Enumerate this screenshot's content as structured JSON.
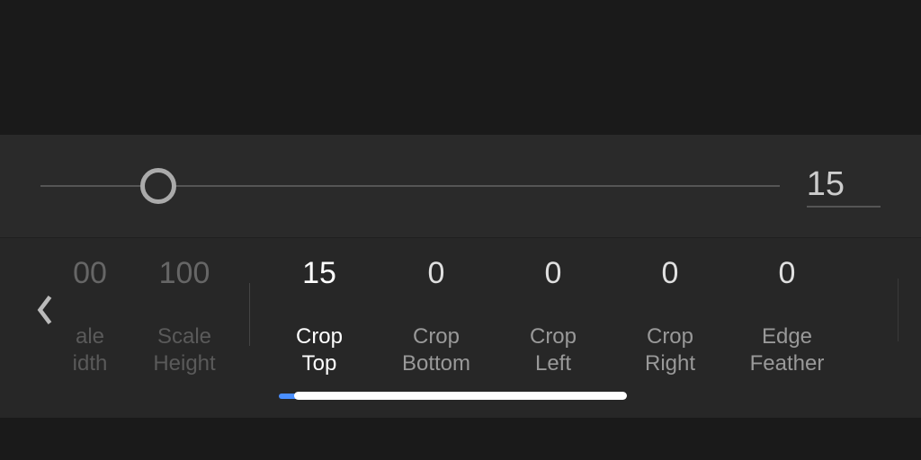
{
  "slider": {
    "display_value": "15"
  },
  "params": {
    "scale_width": {
      "value": "00",
      "label": "ale\nidth"
    },
    "scale_height": {
      "value": "100",
      "label": "Scale\nHeight"
    },
    "crop_top": {
      "value": "15",
      "label": "Crop\nTop"
    },
    "crop_bottom": {
      "value": "0",
      "label": "Crop\nBottom"
    },
    "crop_left": {
      "value": "0",
      "label": "Crop\nLeft"
    },
    "crop_right": {
      "value": "0",
      "label": "Crop\nRight"
    },
    "edge_feather": {
      "value": "0",
      "label": "Edge\nFeather"
    }
  }
}
